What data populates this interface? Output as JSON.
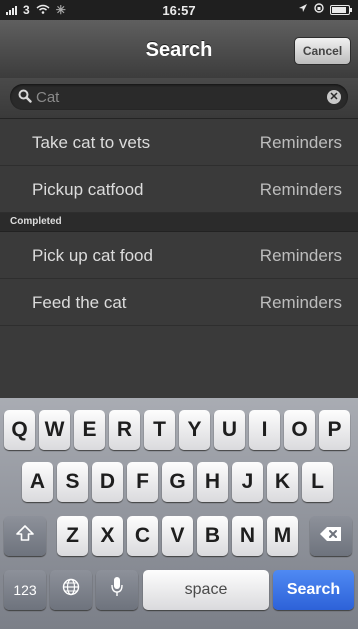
{
  "status_bar": {
    "carrier": "3",
    "time": "16:57",
    "icons": [
      "signal-bars-icon",
      "wifi-icon",
      "activity-spinner-icon",
      "location-arrow-icon",
      "lock-rotation-icon",
      "battery-icon"
    ]
  },
  "navbar": {
    "title": "Search",
    "cancel_label": "Cancel"
  },
  "search": {
    "value": "Cat",
    "icon": "search-icon",
    "clear_icon": "clear-icon"
  },
  "results": {
    "active": [
      {
        "title": "Take cat to vets",
        "source": "Reminders"
      },
      {
        "title": "Pickup catfood",
        "source": "Reminders"
      }
    ],
    "completed_header": "Completed",
    "completed": [
      {
        "title": "Pick up cat food",
        "source": "Reminders"
      },
      {
        "title": "Feed the cat",
        "source": "Reminders"
      }
    ]
  },
  "keyboard": {
    "row1": [
      "Q",
      "W",
      "E",
      "R",
      "T",
      "Y",
      "U",
      "I",
      "O",
      "P"
    ],
    "row2": [
      "A",
      "S",
      "D",
      "F",
      "G",
      "H",
      "J",
      "K",
      "L"
    ],
    "row3": [
      "Z",
      "X",
      "C",
      "V",
      "B",
      "N",
      "M"
    ],
    "numbers_label": "123",
    "space_label": "space",
    "search_label": "Search",
    "icons": [
      "shift-icon",
      "backspace-icon",
      "globe-icon",
      "microphone-icon"
    ]
  },
  "colors": {
    "background": "#3a3a3a",
    "search_key": "#2d62d8"
  }
}
